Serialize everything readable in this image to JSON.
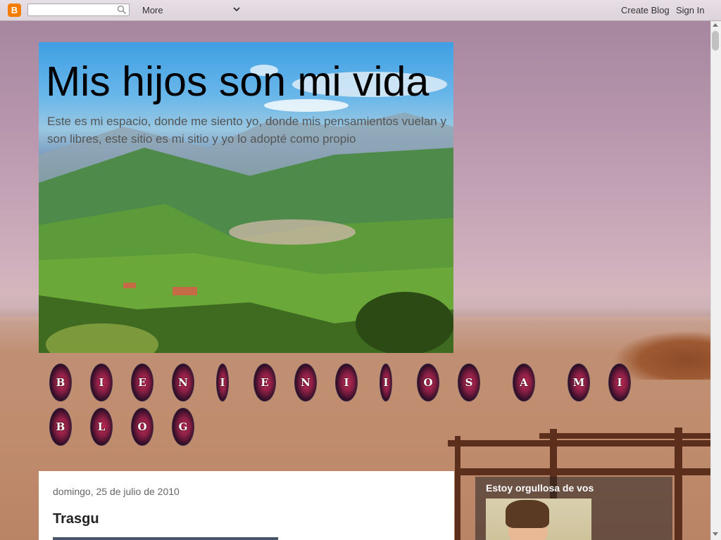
{
  "navbar": {
    "logo_letter": "B",
    "search_placeholder": "",
    "more_label": "More",
    "create_blog_label": "Create Blog",
    "sign_in_label": "Sign In"
  },
  "header": {
    "title": "Mis hijos son mi vida",
    "description": "Este es mi espacio, donde me siento yo, donde mis pensamientos vuelan y son libres, este sitio es mi sitio y yo lo adopté como propio"
  },
  "hearts_row1": [
    "B",
    "I",
    "E",
    "N",
    "I",
    "E",
    "N",
    "I",
    "I",
    "O",
    "S",
    "A",
    "M",
    "I"
  ],
  "hearts_row2": [
    "B",
    "L",
    "O",
    "G"
  ],
  "post": {
    "date": "domingo, 25 de julio de 2010",
    "title": "Trasgu"
  },
  "sidebar": {
    "widget_title": "Estoy orgullosa de vos"
  },
  "colors": {
    "accent_orange": "#f57d00",
    "heart_red": "#c22a55",
    "post_bg": "#ffffff"
  }
}
